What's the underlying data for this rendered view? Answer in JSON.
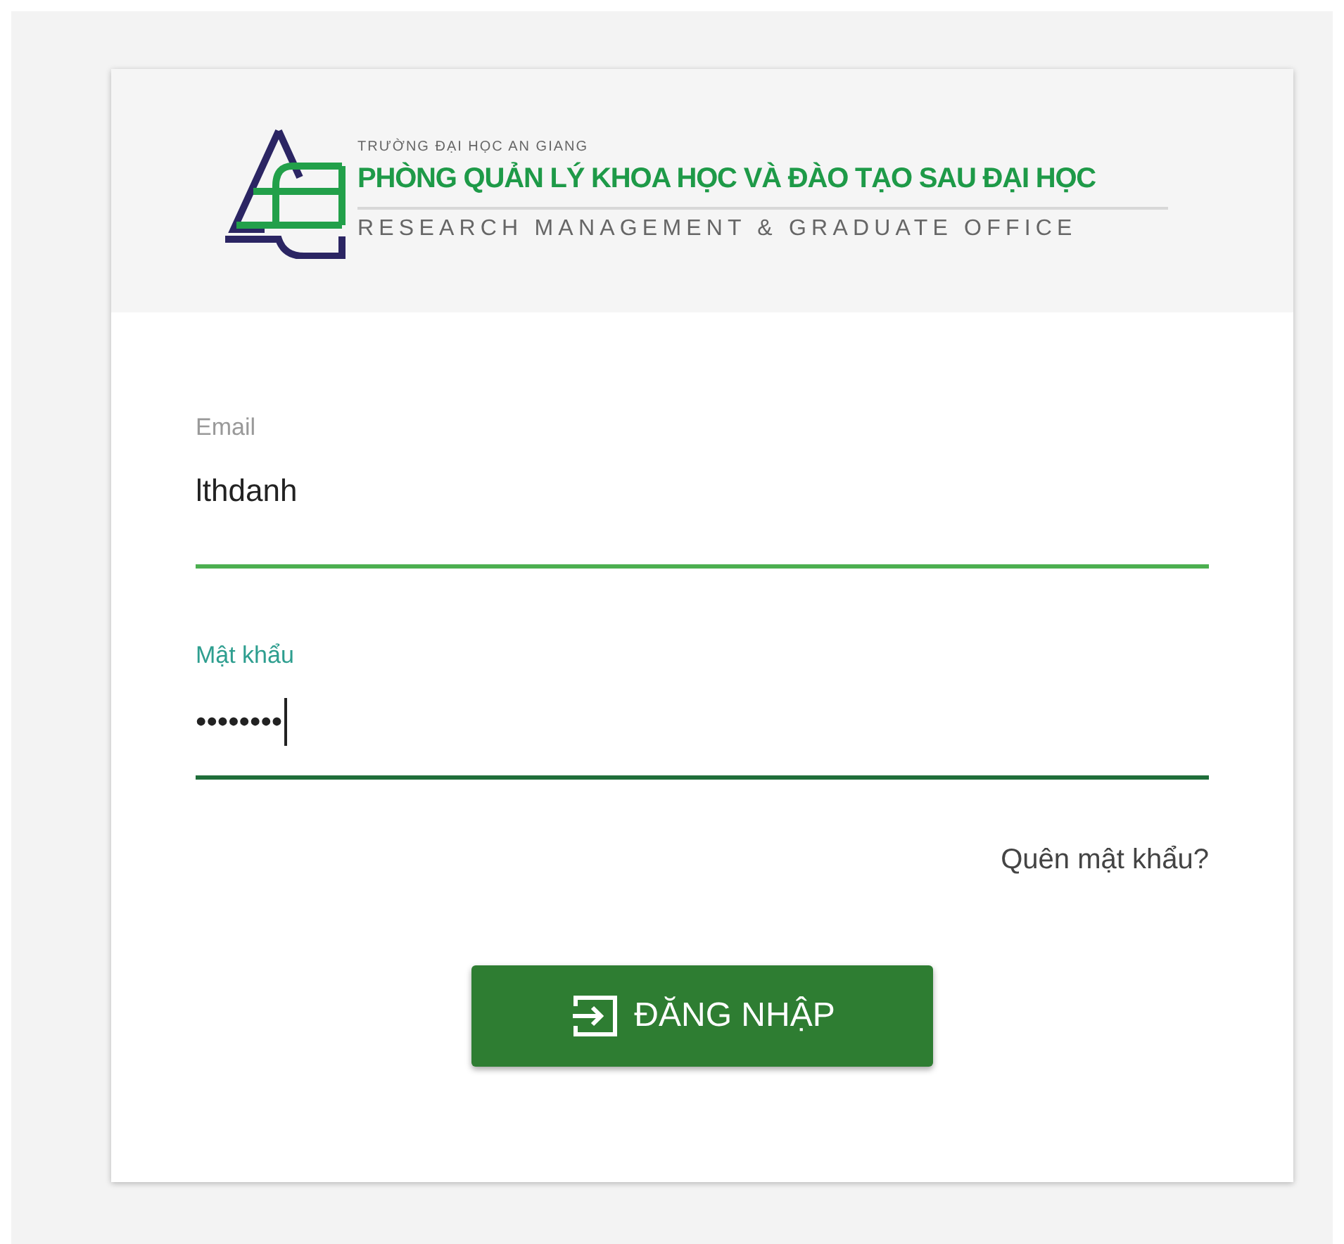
{
  "logo": {
    "university": "TRƯỜNG ĐẠI HỌC AN GIANG",
    "office": "PHÒNG QUẢN LÝ KHOA HỌC VÀ ĐÀO TẠO SAU ĐẠI HỌC",
    "office_en": "RESEARCH MANAGEMENT & GRADUATE OFFICE"
  },
  "fields": [
    {
      "label": "Email",
      "value": "lthdanh",
      "focused": false
    },
    {
      "label": "Mật khẩu",
      "value": "••••••••",
      "focused": true
    }
  ],
  "forgot_link": "Quên mật khẩu?",
  "login_button": "ĐĂNG NHẬP"
}
